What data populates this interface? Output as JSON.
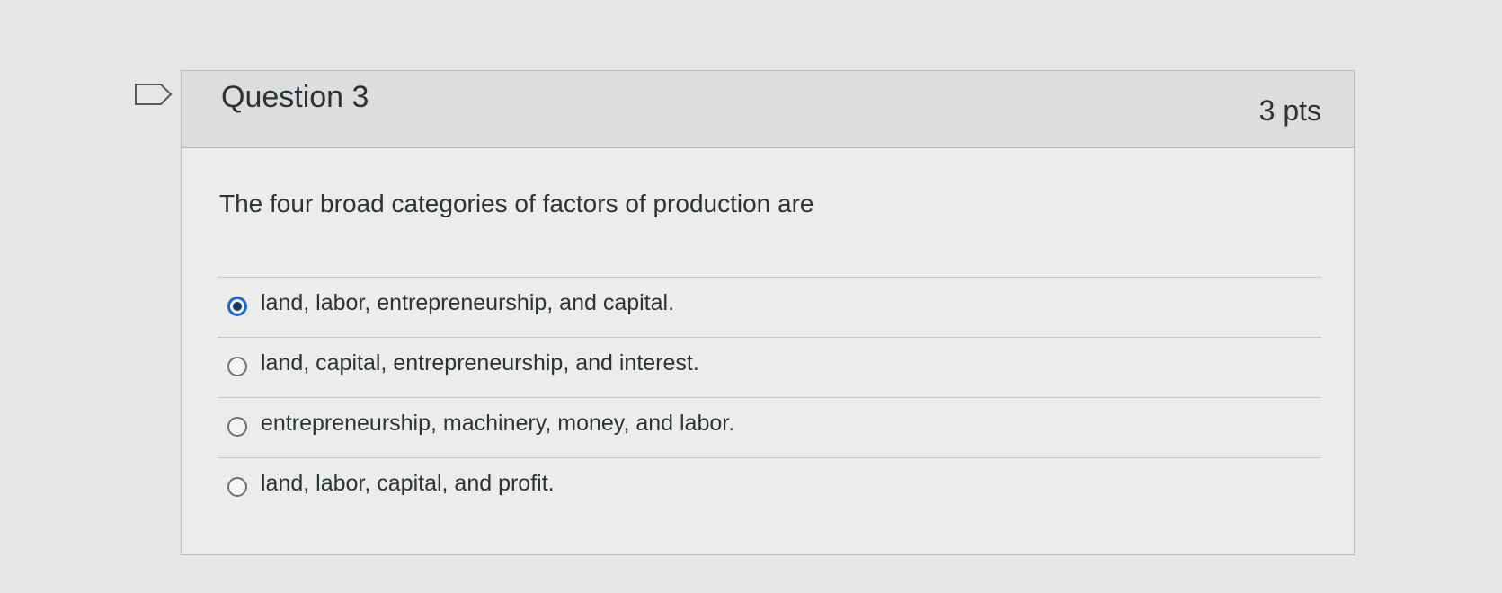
{
  "question": {
    "title": "Question 3",
    "points": "3 pts",
    "text": "The four broad categories of factors of production are",
    "answers": [
      {
        "label": "land, labor, entrepreneurship, and capital.",
        "selected": true
      },
      {
        "label": "land, capital, entrepreneurship, and interest.",
        "selected": false
      },
      {
        "label": "entrepreneurship, machinery, money, and labor.",
        "selected": false
      },
      {
        "label": "land, labor, capital, and profit.",
        "selected": false
      }
    ]
  },
  "icons": {
    "flag": "flag-question-icon",
    "selected_radio": "radio-selected-icon",
    "unselected_radio": "radio-unselected-icon"
  },
  "colors": {
    "accent": "#1b68d6",
    "page_background": "#e6e6e4",
    "header_background": "#dcdddc",
    "text": "#2b3338"
  }
}
